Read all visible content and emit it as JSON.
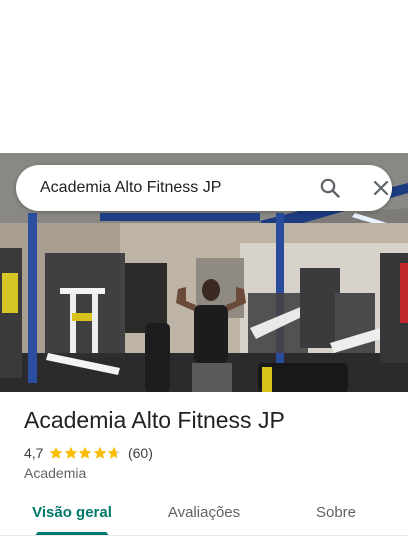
{
  "search": {
    "query": "Academia Alto Fitness JP"
  },
  "icons": {
    "search": "search-icon",
    "close": "close-icon"
  },
  "place": {
    "name": "Academia Alto Fitness JP",
    "rating_text": "4,7",
    "rating": 4.7,
    "max_rating": 5,
    "reviews_count": "(60)",
    "category": "Academia"
  },
  "tabs": [
    {
      "label": "Visão geral",
      "active": true
    },
    {
      "label": "Avaliações",
      "active": false
    },
    {
      "label": "Sobre",
      "active": false
    }
  ],
  "colors": {
    "accent": "#00796b",
    "star": "#fbbc04",
    "star_empty": "#dadce0"
  }
}
